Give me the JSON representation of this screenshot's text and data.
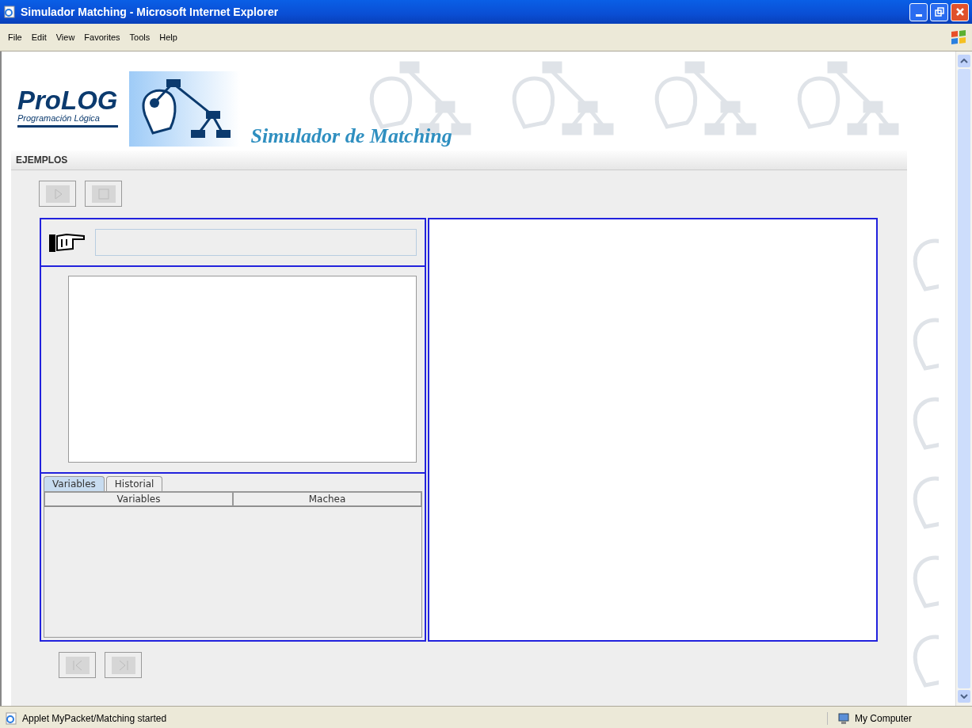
{
  "window": {
    "title": "Simulador Matching - Microsoft Internet Explorer"
  },
  "menu": [
    "File",
    "Edit",
    "View",
    "Favorites",
    "Tools",
    "Help"
  ],
  "logo": {
    "title": "ProLOG",
    "subtitle": "Programación Lógica"
  },
  "banner_title": "Simulador de Matching",
  "section_title": "EJEMPLOS",
  "top_buttons": [
    {
      "kind": "play",
      "disabled": true
    },
    {
      "kind": "stop",
      "disabled": true
    }
  ],
  "tabs": [
    {
      "label": "Variables",
      "selected": true
    },
    {
      "label": "Historial",
      "selected": false
    }
  ],
  "table": {
    "columns": [
      "Variables",
      "Machea"
    ]
  },
  "bottom_buttons": [
    {
      "kind": "first",
      "disabled": true
    },
    {
      "kind": "last",
      "disabled": true
    }
  ],
  "status_bar": {
    "text": "Applet MyPacket/Matching started",
    "zone": "My Computer"
  }
}
